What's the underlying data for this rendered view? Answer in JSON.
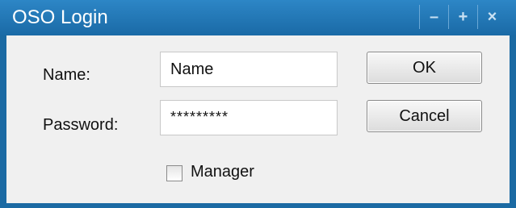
{
  "window": {
    "title": "OSO Login",
    "controls": {
      "minimize": "–",
      "maximize": "+",
      "close": "×"
    },
    "colors": {
      "titlebar": "#1f73b1",
      "body": "#f0f0f0"
    }
  },
  "form": {
    "name_label": "Name:",
    "name_value": "Name",
    "password_label": "Password:",
    "password_value": "*********",
    "manager_label": "Manager",
    "manager_checked": false
  },
  "buttons": {
    "ok": "OK",
    "cancel": "Cancel"
  }
}
